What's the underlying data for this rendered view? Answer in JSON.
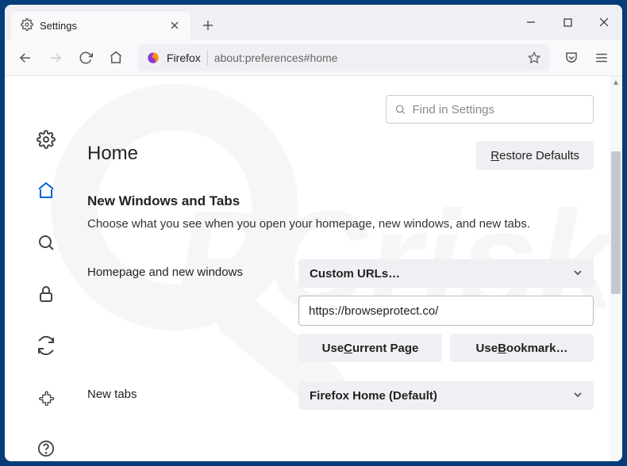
{
  "tab": {
    "title": "Settings"
  },
  "urlbar": {
    "brand": "Firefox",
    "url": "about:preferences#home"
  },
  "search": {
    "placeholder": "Find in Settings"
  },
  "page": {
    "title": "Home",
    "restore": "estore Defaults",
    "restore_key": "R"
  },
  "section": {
    "title": "New Windows and Tabs",
    "desc": "Choose what you see when you open your homepage, new windows, and new tabs."
  },
  "homepage": {
    "label": "Homepage and new windows",
    "select": "Custom URLs…",
    "url": "https://browseprotect.co/",
    "use_current": "urrent Page",
    "use_current_key": "C",
    "use_bookmark": "ookmark…",
    "use_bookmark_key": "B",
    "use_prefix": "Use "
  },
  "newtabs": {
    "label": "New tabs",
    "select": "Firefox Home (Default)"
  }
}
